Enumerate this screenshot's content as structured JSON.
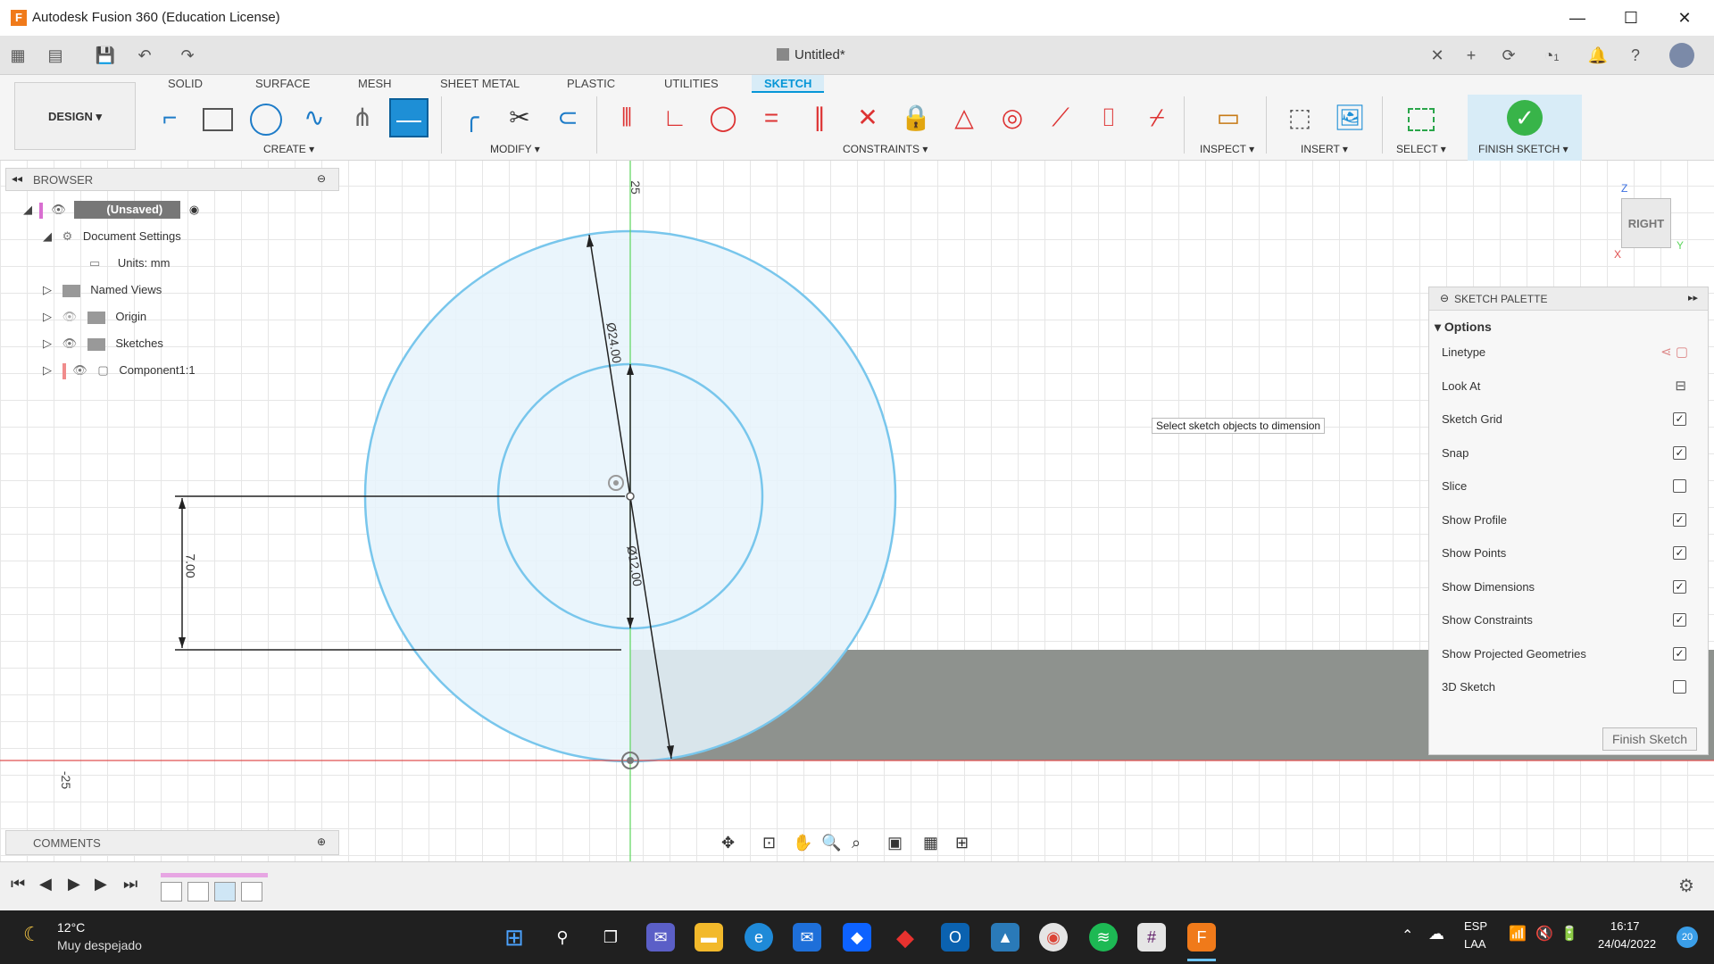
{
  "window": {
    "title": "Autodesk Fusion 360 (Education License)",
    "app_icon": "F"
  },
  "document_tab": {
    "title": "Untitled*"
  },
  "ribbon": {
    "workspace": "DESIGN ▾",
    "tabs": [
      "SOLID",
      "SURFACE",
      "MESH",
      "SHEET METAL",
      "PLASTIC",
      "UTILITIES",
      "SKETCH"
    ],
    "active_tab": "SKETCH",
    "groups": {
      "create": "CREATE ▾",
      "modify": "MODIFY ▾",
      "constraints": "CONSTRAINTS ▾",
      "inspect": "INSPECT ▾",
      "insert": "INSERT ▾",
      "select": "SELECT ▾",
      "finish": "FINISH SKETCH ▾"
    }
  },
  "browser": {
    "title": "BROWSER",
    "root": "(Unsaved)",
    "items": [
      {
        "label": "Document Settings"
      },
      {
        "label": "Units: mm"
      },
      {
        "label": "Named Views"
      },
      {
        "label": "Origin"
      },
      {
        "label": "Sketches"
      },
      {
        "label": "Component1:1"
      }
    ]
  },
  "viewcube": {
    "face": "RIGHT",
    "axis_z": "Z",
    "axis_y": "Y",
    "axis_x": "X"
  },
  "sketch": {
    "tooltip": "Select sketch objects to dimension",
    "dim_outer": "Ø24.00",
    "dim_inner": "Ø12.00",
    "dim_height": "7.00",
    "ruler_top": "25",
    "ruler_bottom": "-25",
    "colors": {
      "circle": "#78c6ec",
      "fill": "#e6f3fb",
      "profile": "#8e928e",
      "axis_green": "#5cd65c",
      "axis_red": "#e05050"
    }
  },
  "palette": {
    "title": "SKETCH PALETTE",
    "section": "Options",
    "rows": [
      {
        "label": "Linetype",
        "kind": "icons"
      },
      {
        "label": "Look At",
        "kind": "icon"
      },
      {
        "label": "Sketch Grid",
        "checked": true
      },
      {
        "label": "Snap",
        "checked": true
      },
      {
        "label": "Slice",
        "checked": false
      },
      {
        "label": "Show Profile",
        "checked": true
      },
      {
        "label": "Show Points",
        "checked": true
      },
      {
        "label": "Show Dimensions",
        "checked": true
      },
      {
        "label": "Show Constraints",
        "checked": true
      },
      {
        "label": "Show Projected Geometries",
        "checked": true
      },
      {
        "label": "3D Sketch",
        "checked": false
      }
    ],
    "finish_button": "Finish Sketch"
  },
  "comments": {
    "title": "COMMENTS"
  },
  "taskbar": {
    "weather_temp": "12°C",
    "weather_desc": "Muy despejado",
    "lang_1": "ESP",
    "lang_2": "LAA",
    "time": "16:17",
    "date": "24/04/2022",
    "notification_count": "20"
  },
  "header_badge": "1"
}
